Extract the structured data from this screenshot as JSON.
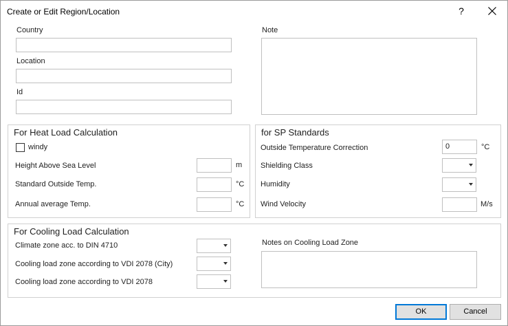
{
  "dialog": {
    "title": "Create or Edit Region/Location",
    "help_label": "?"
  },
  "general": {
    "country_label": "Country",
    "country_value": "",
    "location_label": "Location",
    "location_value": "",
    "id_label": "Id",
    "id_value": "",
    "note_label": "Note",
    "note_value": ""
  },
  "heat_load": {
    "title": "For Heat Load Calculation",
    "windy_label": "windy",
    "windy_checked": false,
    "height_label": "Height Above Sea Level",
    "height_value": "",
    "height_unit": "m",
    "std_outside_label": "Standard Outside Temp.",
    "std_outside_value": "",
    "std_outside_unit": "°C",
    "annual_avg_label": "Annual average Temp.",
    "annual_avg_value": "",
    "annual_avg_unit": "°C"
  },
  "sp_standards": {
    "title": "for SP Standards",
    "outside_corr_label": "Outside Temperature Correction",
    "outside_corr_value": "0",
    "outside_corr_unit": "°C",
    "shielding_label": "Shielding Class",
    "shielding_value": "",
    "humidity_label": "Humidity",
    "humidity_value": "",
    "wind_label": "Wind Velocity",
    "wind_value": "",
    "wind_unit": "M/s"
  },
  "cooling_load": {
    "title": "For Cooling Load Calculation",
    "climate_zone_label": "Climate zone acc. to DIN 4710",
    "climate_zone_value": "",
    "zone_city_label": "Cooling load zone according to VDI 2078 (City)",
    "zone_city_value": "",
    "zone_label": "Cooling load zone according to VDI 2078",
    "zone_value": "",
    "notes_label": "Notes on Cooling Load Zone",
    "notes_value": ""
  },
  "buttons": {
    "ok_label": "OK",
    "cancel_label": "Cancel"
  }
}
